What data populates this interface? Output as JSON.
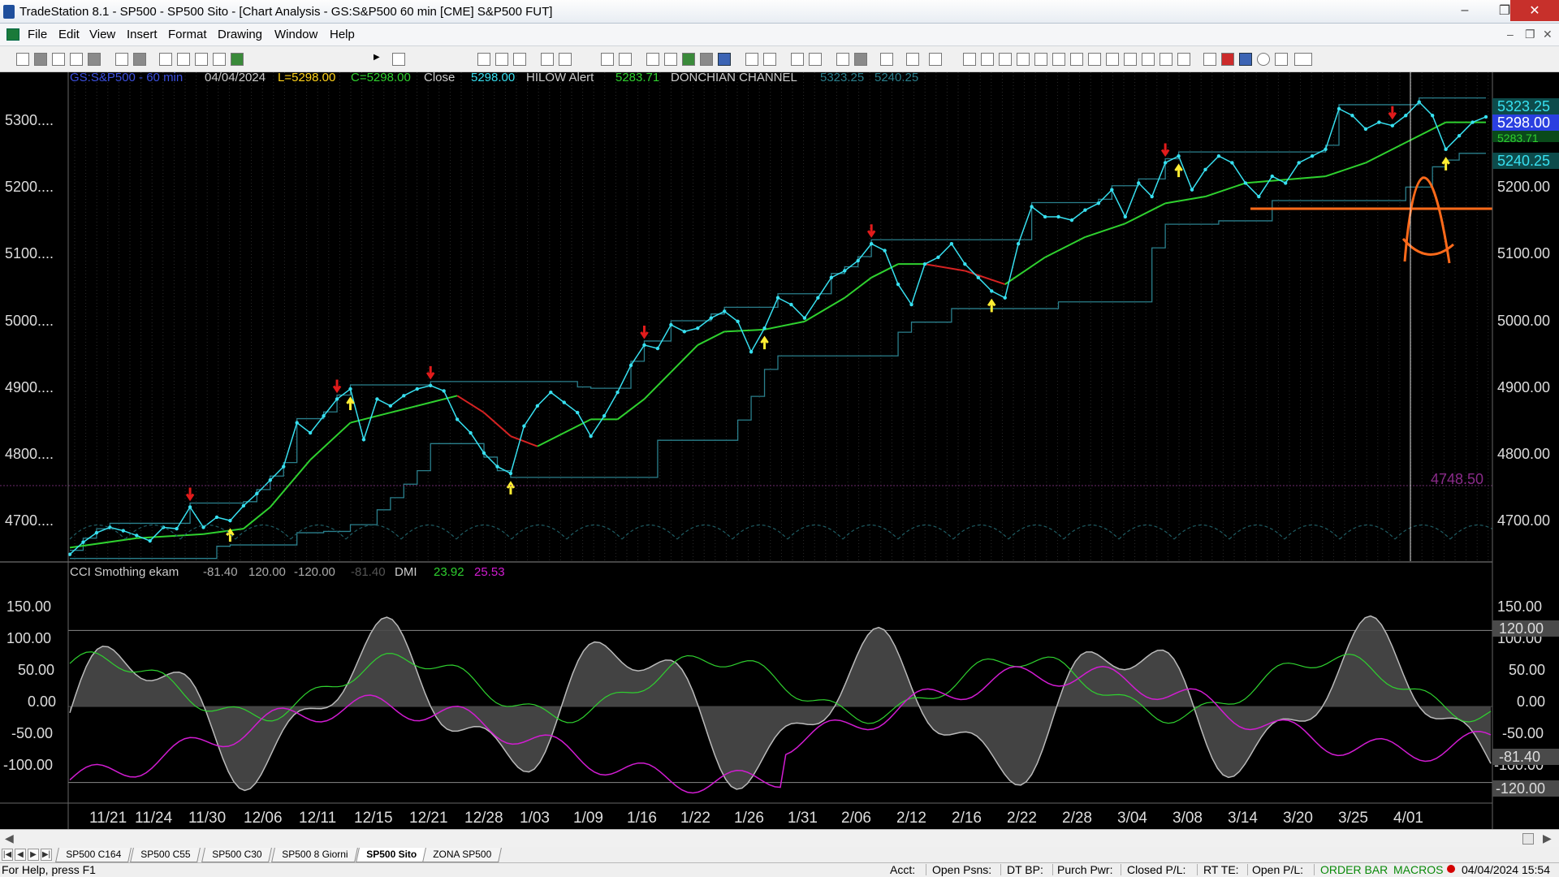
{
  "window": {
    "title": "TradeStation 8.1 - SP500 - SP500 Sito - [Chart Analysis - GS:S&P500  60 min  [CME] S&P500 FUT]"
  },
  "menu": [
    "File",
    "Edit",
    "View",
    "Insert",
    "Format",
    "Drawing",
    "Window",
    "Help"
  ],
  "chart_header": {
    "symbol": "GS:S&P500 - 60 min",
    "date": "04/04/2024",
    "low": "L=5298.00",
    "close": "C=5298.00",
    "close_label": "Close",
    "close_value": "5298.00",
    "hilow_label": "HILOW Alert",
    "hilow_value": "5283.71",
    "donchian_label": "DONCHIAN CHANNEL",
    "donchian_upper": "5323.25",
    "donchian_lower": "5240.25"
  },
  "indicator_header": {
    "name": "CCI Smothing ekam",
    "v1": "-81.40",
    "v2": "120.00",
    "v3": "-120.00",
    "v4": "-81.40",
    "dmi_label": "DMI",
    "dmi_plus": "23.92",
    "dmi_minus": "25.53"
  },
  "price_axis": {
    "left_labels": [
      "5300....",
      "5200....",
      "5100....",
      "5000....",
      "4900....",
      "4800....",
      "4700...."
    ],
    "right_labels": [
      "5200.00",
      "5100.00",
      "5000.00",
      "4900.00",
      "4800.00",
      "4700.00"
    ],
    "markers": {
      "upper": "5323.25",
      "last": "5298.00",
      "hilow": "5283.71",
      "lower": "5240.25",
      "level": "4748.50"
    }
  },
  "osc_axis": {
    "left_labels": [
      "150.00",
      "100.00",
      "50.00",
      "0.00",
      "-50.00",
      "-100.00"
    ],
    "right_labels": [
      "150.00",
      "100.00",
      "50.00",
      "0.00",
      "-50.00",
      "-100.00"
    ],
    "markers": {
      "upper": "120.00",
      "current": "-81.40",
      "lower": "-120.00"
    }
  },
  "time_axis": [
    "11/21",
    "11/24",
    "11/30",
    "12/06",
    "12/11",
    "12/15",
    "12/21",
    "12/28",
    "1/03",
    "1/09",
    "1/16",
    "1/22",
    "1/26",
    "1/31",
    "2/06",
    "2/12",
    "2/16",
    "2/22",
    "2/28",
    "3/04",
    "3/08",
    "3/14",
    "3/20",
    "3/25",
    "4/01"
  ],
  "tabs": [
    "SP500 C164",
    "SP500 C55",
    "SP500 C30",
    "SP500 8 Giorni",
    "SP500 Sito",
    "ZONA SP500"
  ],
  "active_tab": "SP500 Sito",
  "status": {
    "help": "For Help, press F1",
    "acct": "Acct:",
    "open_psns": "Open Psns:",
    "dt_bp": "DT BP:",
    "purch_pwr": "Purch Pwr:",
    "closed_pl": "Closed P/L:",
    "rt_te": "RT TE:",
    "open_pl": "Open P/L:",
    "order_bar": "ORDER BAR",
    "macros": "MACROS",
    "datetime": "04/04/2024 15:54"
  },
  "colors": {
    "price": "#37e0f0",
    "ma_up": "#2fd12f",
    "ma_down": "#d62222",
    "channel": "#2a7f8c",
    "orange_line": "#ff6a1a",
    "dmi_minus": "#d21cd2",
    "osc_fill": "#4a4a4a"
  },
  "chart_data": {
    "type": "line",
    "price_points": [
      [
        0,
        4650
      ],
      [
        2,
        4668
      ],
      [
        4,
        4682
      ],
      [
        6,
        4690
      ],
      [
        8,
        4685
      ],
      [
        10,
        4678
      ],
      [
        12,
        4670
      ],
      [
        14,
        4690
      ],
      [
        16,
        4688
      ],
      [
        18,
        4720
      ],
      [
        20,
        4690
      ],
      [
        22,
        4705
      ],
      [
        24,
        4700
      ],
      [
        26,
        4722
      ],
      [
        28,
        4740
      ],
      [
        30,
        4760
      ],
      [
        32,
        4780
      ],
      [
        34,
        4845
      ],
      [
        36,
        4830
      ],
      [
        38,
        4855
      ],
      [
        40,
        4880
      ],
      [
        42,
        4895
      ],
      [
        44,
        4820
      ],
      [
        46,
        4880
      ],
      [
        48,
        4870
      ],
      [
        50,
        4885
      ],
      [
        52,
        4895
      ],
      [
        54,
        4900
      ],
      [
        56,
        4892
      ],
      [
        58,
        4850
      ],
      [
        60,
        4830
      ],
      [
        62,
        4800
      ],
      [
        64,
        4780
      ],
      [
        66,
        4770
      ],
      [
        68,
        4840
      ],
      [
        70,
        4870
      ],
      [
        72,
        4890
      ],
      [
        74,
        4875
      ],
      [
        76,
        4860
      ],
      [
        78,
        4825
      ],
      [
        80,
        4855
      ],
      [
        82,
        4890
      ],
      [
        84,
        4930
      ],
      [
        86,
        4960
      ],
      [
        88,
        4955
      ],
      [
        90,
        4990
      ],
      [
        92,
        4980
      ],
      [
        94,
        4985
      ],
      [
        96,
        5000
      ],
      [
        98,
        5010
      ],
      [
        100,
        4995
      ],
      [
        102,
        4950
      ],
      [
        104,
        4985
      ],
      [
        106,
        5030
      ],
      [
        108,
        5020
      ],
      [
        110,
        5000
      ],
      [
        112,
        5030
      ],
      [
        114,
        5060
      ],
      [
        116,
        5070
      ],
      [
        118,
        5085
      ],
      [
        120,
        5110
      ],
      [
        122,
        5100
      ],
      [
        124,
        5050
      ],
      [
        126,
        5020
      ],
      [
        128,
        5080
      ],
      [
        130,
        5090
      ],
      [
        132,
        5110
      ],
      [
        134,
        5080
      ],
      [
        136,
        5060
      ],
      [
        138,
        5040
      ],
      [
        140,
        5030
      ],
      [
        142,
        5110
      ],
      [
        144,
        5165
      ],
      [
        146,
        5150
      ],
      [
        148,
        5150
      ],
      [
        150,
        5145
      ],
      [
        152,
        5160
      ],
      [
        154,
        5170
      ],
      [
        156,
        5190
      ],
      [
        158,
        5150
      ],
      [
        160,
        5200
      ],
      [
        162,
        5180
      ],
      [
        164,
        5230
      ],
      [
        166,
        5240
      ],
      [
        168,
        5190
      ],
      [
        170,
        5220
      ],
      [
        172,
        5240
      ],
      [
        174,
        5230
      ],
      [
        176,
        5200
      ],
      [
        178,
        5180
      ],
      [
        180,
        5210
      ],
      [
        182,
        5200
      ],
      [
        184,
        5230
      ],
      [
        186,
        5240
      ],
      [
        188,
        5250
      ],
      [
        190,
        5310
      ],
      [
        192,
        5300
      ],
      [
        194,
        5280
      ],
      [
        196,
        5290
      ],
      [
        198,
        5285
      ],
      [
        200,
        5300
      ],
      [
        202,
        5320
      ],
      [
        204,
        5300
      ],
      [
        206,
        5250
      ],
      [
        208,
        5270
      ],
      [
        210,
        5290
      ],
      [
        212,
        5298
      ]
    ],
    "ma_points": [
      [
        0,
        4660
      ],
      [
        10,
        4674
      ],
      [
        20,
        4680
      ],
      [
        26,
        4688
      ],
      [
        30,
        4720
      ],
      [
        36,
        4790
      ],
      [
        42,
        4845
      ],
      [
        48,
        4860
      ],
      [
        54,
        4875
      ],
      [
        58,
        4885
      ],
      [
        62,
        4860
      ],
      [
        66,
        4825
      ],
      [
        70,
        4810
      ],
      [
        74,
        4830
      ],
      [
        78,
        4850
      ],
      [
        82,
        4850
      ],
      [
        86,
        4880
      ],
      [
        90,
        4920
      ],
      [
        94,
        4960
      ],
      [
        98,
        4980
      ],
      [
        104,
        4983
      ],
      [
        110,
        4995
      ],
      [
        116,
        5030
      ],
      [
        120,
        5060
      ],
      [
        124,
        5080
      ],
      [
        128,
        5080
      ],
      [
        134,
        5070
      ],
      [
        140,
        5050
      ],
      [
        146,
        5090
      ],
      [
        152,
        5120
      ],
      [
        158,
        5140
      ],
      [
        164,
        5170
      ],
      [
        170,
        5180
      ],
      [
        176,
        5200
      ],
      [
        182,
        5205
      ],
      [
        188,
        5210
      ],
      [
        194,
        5230
      ],
      [
        200,
        5260
      ],
      [
        206,
        5290
      ],
      [
        212,
        5290
      ]
    ],
    "y_range": [
      4640,
      5340
    ],
    "osc_range": [
      -150,
      180
    ]
  }
}
